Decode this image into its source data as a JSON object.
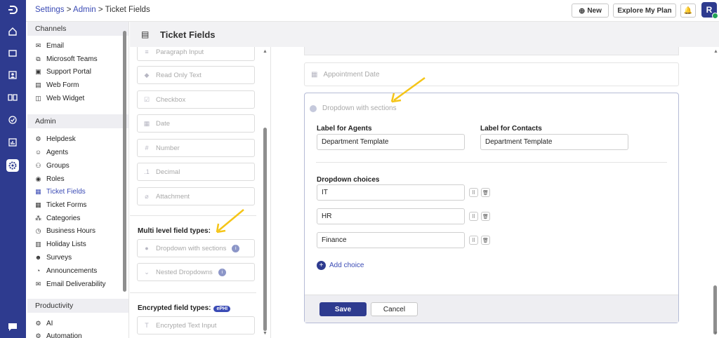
{
  "breadcrumb": {
    "settings": "Settings",
    "sep1": ">",
    "admin": "Admin",
    "sep2": ">",
    "current": "Ticket Fields"
  },
  "topbar": {
    "new_label": "New",
    "explore_label": "Explore My Plan",
    "avatar_initial": "R"
  },
  "rail": {
    "icons": [
      "logo-icon",
      "home-icon",
      "ticket-icon",
      "contacts-icon",
      "knowledge-icon",
      "tasks-icon",
      "reports-icon",
      "settings-icon",
      "chat-icon"
    ]
  },
  "sidebar": {
    "channels_header": "Channels",
    "channels": [
      "Email",
      "Microsoft Teams",
      "Support Portal",
      "Web Form",
      "Web Widget"
    ],
    "admin_header": "Admin",
    "admin": [
      "Helpdesk",
      "Agents",
      "Groups",
      "Roles",
      "Ticket Fields",
      "Ticket Forms",
      "Categories",
      "Business Hours",
      "Holiday Lists",
      "Surveys",
      "Announcements",
      "Email Deliverability"
    ],
    "productivity_header": "Productivity",
    "productivity": [
      "AI",
      "Automation"
    ],
    "active_item": "Ticket Fields"
  },
  "page": {
    "title": "Ticket Fields"
  },
  "palette": {
    "fields": [
      "Paragraph Input",
      "Read Only Text",
      "Checkbox",
      "Date",
      "Number",
      "Decimal",
      "Attachment"
    ],
    "multi_level_label": "Multi level field types:",
    "multi_level": [
      "Dropdown with sections",
      "Nested Dropdowns"
    ],
    "encrypted_label": "Encrypted field types:",
    "ephi_badge": "ePHI",
    "encrypted": [
      "Encrypted Text Input"
    ]
  },
  "canvas": {
    "appointment_field": "Appointment Date",
    "card_title": "Dropdown with sections",
    "label_agents": "Label for Agents",
    "label_agents_value": "Department Template",
    "label_contacts": "Label for Contacts",
    "label_contacts_value": "Department Template",
    "choices_label": "Dropdown choices",
    "choices": [
      "IT",
      "HR",
      "Finance"
    ],
    "add_choice": "Add choice",
    "save_label": "Save",
    "cancel_label": "Cancel"
  },
  "colors": {
    "brand": "#2e3b8f",
    "link": "#3b4bb5",
    "annotation_arrow": "#f5c518"
  }
}
